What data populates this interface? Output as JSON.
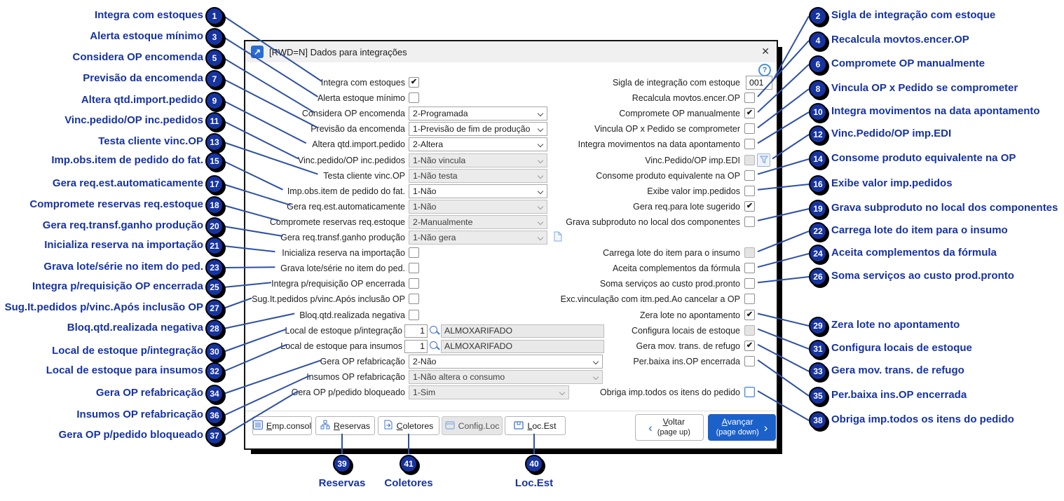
{
  "window": {
    "title": "[RWD=N] Dados para integrações",
    "close_glyph": "✕",
    "help_glyph": "?"
  },
  "form": {
    "left_rows": [
      {
        "label": "Integra com estoques",
        "type": "check",
        "checked": true
      },
      {
        "label": "Alerta estoque mínimo",
        "type": "check",
        "checked": false
      },
      {
        "label": "Considera OP encomenda",
        "type": "select",
        "value": "2-Programada"
      },
      {
        "label": "Previsão da encomenda",
        "type": "select",
        "value": "1-Previsão de fim de produção"
      },
      {
        "label": "Altera qtd.import.pedido",
        "type": "select",
        "value": "2-Altera"
      },
      {
        "label": "Vinc.pedido/OP inc.pedidos",
        "type": "select",
        "value": "1-Não vincula",
        "disabled": true
      },
      {
        "label": "Testa cliente vinc.OP",
        "type": "select",
        "value": "1-Não testa",
        "disabled": true
      },
      {
        "label": "Imp.obs.item de pedido do fat.",
        "type": "select",
        "value": "1-Não"
      },
      {
        "label": "Gera req.est.automaticamente",
        "type": "select",
        "value": "1-Não",
        "disabled": true
      },
      {
        "label": "Compromete reservas req.estoque",
        "type": "select",
        "value": "2-Manualmente",
        "disabled": true
      },
      {
        "label": "Gera req.transf.ganho produção",
        "type": "select",
        "value": "1-Não gera",
        "disabled": true,
        "icon": "document-icon"
      },
      {
        "label": "Inicializa reserva na importação",
        "type": "check",
        "checked": false
      },
      {
        "label": "Grava lote/série no item do ped.",
        "type": "check",
        "checked": false
      },
      {
        "label": "Integra p/requisição OP encerrada",
        "type": "check",
        "checked": false
      },
      {
        "label": "Sug.It.pedidos p/vinc.Após inclusão OP",
        "type": "check",
        "checked": false
      },
      {
        "label": "Bloq.qtd.realizada negativa",
        "type": "check",
        "checked": false
      },
      {
        "label": "Local de estoque p/integração",
        "type": "lookup",
        "code": "1",
        "value": "ALMOXARIFADO"
      },
      {
        "label": "Local de estoque para insumos",
        "type": "lookup",
        "code": "1",
        "value": "ALMOXARIFADO"
      },
      {
        "label": "Gera OP refabricação",
        "type": "select",
        "value": "2-Não",
        "size": "wide"
      },
      {
        "label": "Insumos OP refabricação",
        "type": "select",
        "value": "1-Não altera o consumo",
        "disabled": true,
        "size": "wide"
      },
      {
        "label": "Gera OP p/pedido bloqueado",
        "type": "select",
        "value": "1-Sim",
        "disabled": true,
        "size": "med"
      }
    ],
    "right_rows": [
      {
        "row": 0,
        "label": "Sigla de integração com estoque",
        "type": "text",
        "value": "001"
      },
      {
        "row": 1,
        "label": "Recalcula movtos.encer.OP",
        "type": "check",
        "checked": false
      },
      {
        "row": 2,
        "label": "Compromete OP manualmente",
        "type": "check",
        "checked": true
      },
      {
        "row": 3,
        "label": "Vincula OP x Pedido se comprometer",
        "type": "check",
        "checked": false
      },
      {
        "row": 4,
        "label": "Integra movimentos na data apontamento",
        "type": "check",
        "checked": false
      },
      {
        "row": 5,
        "label": "Vinc.Pedido/OP imp.EDI",
        "type": "check",
        "checked": false,
        "disabled": true,
        "icon": "filter-icon"
      },
      {
        "row": 6,
        "label": "Consome produto equivalente na OP",
        "type": "check",
        "checked": false
      },
      {
        "row": 7,
        "label": "Exibe valor imp.pedidos",
        "type": "check",
        "checked": false
      },
      {
        "row": 8,
        "label": "Gera req.para lote sugerido",
        "type": "check",
        "checked": true
      },
      {
        "row": 9,
        "label": "Grava subproduto no local dos componentes",
        "type": "check",
        "checked": false
      },
      {
        "row": 11,
        "label": "Carrega lote do item para o insumo",
        "type": "check",
        "checked": false,
        "disabled": true
      },
      {
        "row": 12,
        "label": "Aceita complementos da fórmula",
        "type": "check",
        "checked": false
      },
      {
        "row": 13,
        "label": "Soma serviços ao custo prod.pronto",
        "type": "check",
        "checked": false
      },
      {
        "row": 14,
        "label": "Exc.vinculação com itm.ped.Ao cancelar a OP",
        "type": "check",
        "checked": false
      },
      {
        "row": 15,
        "label": "Zera lote no apontamento",
        "type": "check",
        "checked": true
      },
      {
        "row": 16,
        "label": "Configura locais de estoque",
        "type": "check",
        "checked": false,
        "disabled": true
      },
      {
        "row": 17,
        "label": "Gera mov. trans. de refugo",
        "type": "check",
        "checked": true
      },
      {
        "row": 18,
        "label": "Per.baixa ins.OP encerrada",
        "type": "check",
        "checked": false
      },
      {
        "row": 20,
        "label": "Obriga imp.todos os itens do pedido",
        "type": "check",
        "checked": false,
        "focused": true
      }
    ]
  },
  "toolbar": {
    "buttons": [
      {
        "label": "Emp.consol",
        "underline_index": 0,
        "icon": "list-icon"
      },
      {
        "label": "Reservas",
        "underline_index": 0,
        "icon": "network-icon"
      },
      {
        "label": "Coletores",
        "underline_index": 0,
        "icon": "export-document-icon"
      },
      {
        "label": "Config.Loc",
        "underline_index": 5,
        "icon": "box-icon",
        "disabled": true
      },
      {
        "label": "Loc.Est",
        "underline_index": 0,
        "icon": "package-icon"
      }
    ]
  },
  "nav": {
    "back": {
      "label": "Voltar",
      "sub": "(page up)"
    },
    "next": {
      "label": "Avançar",
      "sub": "(page down)"
    }
  },
  "annotations": {
    "left": [
      {
        "num": "1",
        "label": "Integra com estoques"
      },
      {
        "num": "3",
        "label": "Alerta estoque mínimo"
      },
      {
        "num": "5",
        "label": "Considera OP encomenda"
      },
      {
        "num": "7",
        "label": "Previsão da encomenda"
      },
      {
        "num": "9",
        "label": "Altera qtd.import.pedido"
      },
      {
        "num": "11",
        "label": "Vinc.pedido/OP inc.pedidos"
      },
      {
        "num": "13",
        "label": "Testa cliente vinc.OP"
      },
      {
        "num": "15",
        "label": "Imp.obs.item de pedido do fat."
      },
      {
        "num": "17",
        "label": "Gera req.est.automaticamente"
      },
      {
        "num": "18",
        "label": "Compromete reservas req.estoque"
      },
      {
        "num": "20",
        "label": "Gera req.transf.ganho produção"
      },
      {
        "num": "21",
        "label": "Inicializa reserva na importação"
      },
      {
        "num": "23",
        "label": "Grava lote/série no item do ped."
      },
      {
        "num": "25",
        "label": "Integra p/requisição OP encerrada"
      },
      {
        "num": "27",
        "label": "Sug.It.pedidos p/vinc.Após inclusão OP"
      },
      {
        "num": "28",
        "label": "Bloq.qtd.realizada negativa"
      },
      {
        "num": "30",
        "label": "Local de estoque p/integração"
      },
      {
        "num": "32",
        "label": "Local de estoque para insumos"
      },
      {
        "num": "34",
        "label": "Gera OP refabricação"
      },
      {
        "num": "36",
        "label": "Insumos OP refabricação"
      },
      {
        "num": "37",
        "label": "Gera OP p/pedido bloqueado"
      }
    ],
    "right": [
      {
        "num": "2",
        "label": "Sigla de integração com estoque"
      },
      {
        "num": "4",
        "label": "Recalcula movtos.encer.OP"
      },
      {
        "num": "6",
        "label": "Compromete OP manualmente"
      },
      {
        "num": "8",
        "label": "Vincula OP x Pedido se comprometer"
      },
      {
        "num": "10",
        "label": "Integra movimentos na data apontamento"
      },
      {
        "num": "12",
        "label": "Vinc.Pedido/OP imp.EDI"
      },
      {
        "num": "14",
        "label": "Consome produto equivalente na OP"
      },
      {
        "num": "16",
        "label": "Exibe valor imp.pedidos"
      },
      {
        "num": "19",
        "label": "Grava subproduto no local dos componentes"
      },
      {
        "num": "22",
        "label": "Carrega lote do item para o insumo"
      },
      {
        "num": "24",
        "label": "Aceita complementos da fórmula"
      },
      {
        "num": "26",
        "label": "Soma serviços ao custo prod.pronto"
      },
      {
        "num": "29",
        "label": "Zera lote no apontamento"
      },
      {
        "num": "31",
        "label": "Configura locais de estoque"
      },
      {
        "num": "33",
        "label": "Gera mov. trans. de refugo"
      },
      {
        "num": "35",
        "label": "Per.baixa ins.OP encerrada"
      },
      {
        "num": "38",
        "label": "Obriga imp.todos os itens do pedido"
      }
    ],
    "bottom": [
      {
        "num": "39",
        "label": "Reservas"
      },
      {
        "num": "41",
        "label": "Coletores"
      },
      {
        "num": "40",
        "label": "Loc.Est"
      }
    ]
  },
  "colors": {
    "accent_blue": "#1b61c9",
    "annotation_blue": "#16339f",
    "leader_blue": "#2d50a5",
    "icon_blue": "#3f74cf"
  }
}
